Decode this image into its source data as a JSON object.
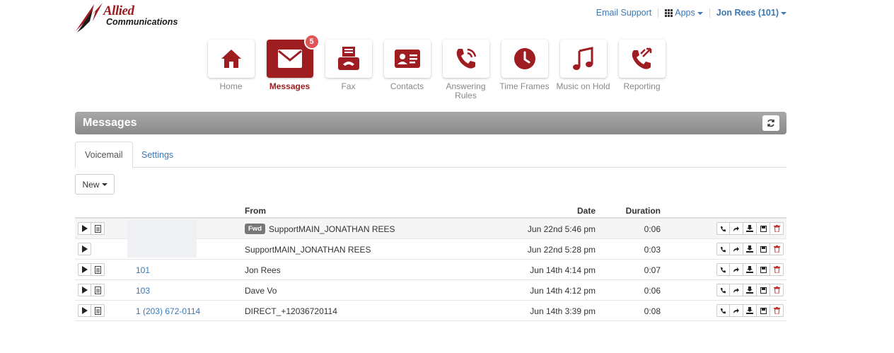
{
  "logo": {
    "line1": "Allied",
    "line2": "Communications"
  },
  "topnav": {
    "email_support": "Email Support",
    "apps": "Apps",
    "user": "Jon Rees (101)"
  },
  "apps": [
    {
      "label": "Home",
      "icon": "home-icon"
    },
    {
      "label": "Messages",
      "icon": "envelope-icon",
      "badge": "5"
    },
    {
      "label": "Fax",
      "icon": "fax-icon"
    },
    {
      "label": "Contacts",
      "icon": "contact-card-icon"
    },
    {
      "label": "Answering Rules",
      "icon": "phone-ringing-icon"
    },
    {
      "label": "Time Frames",
      "icon": "clock-icon"
    },
    {
      "label": "Music on Hold",
      "icon": "music-note-icon"
    },
    {
      "label": "Reporting",
      "icon": "phone-arrows-icon"
    }
  ],
  "panel": {
    "title": "Messages"
  },
  "tabs": {
    "voicemail": "Voicemail",
    "settings": "Settings"
  },
  "new_button": "New",
  "table": {
    "headers": {
      "from": "From",
      "date": "Date",
      "duration": "Duration"
    },
    "fwd_badge": "Fwd",
    "rows": [
      {
        "number": "",
        "from": "SupportMAIN_JONATHAN REES",
        "date": "Jun 22nd 5:46 pm",
        "duration": "0:06"
      },
      {
        "number": "",
        "from": "SupportMAIN_JONATHAN REES",
        "date": "Jun 22nd 5:28 pm",
        "duration": "0:03"
      },
      {
        "number": "101",
        "from": "Jon Rees",
        "date": "Jun 14th 4:14 pm",
        "duration": "0:07"
      },
      {
        "number": "103",
        "from": "Dave Vo",
        "date": "Jun 14th 4:12 pm",
        "duration": "0:06"
      },
      {
        "number": "1 (203) 672-0114",
        "from": "DIRECT_+12036720114",
        "date": "Jun 14th 3:39 pm",
        "duration": "0:08"
      }
    ]
  },
  "colors": {
    "brand": "#9e1d21",
    "link": "#3a78b5",
    "badge": "#e05555"
  }
}
